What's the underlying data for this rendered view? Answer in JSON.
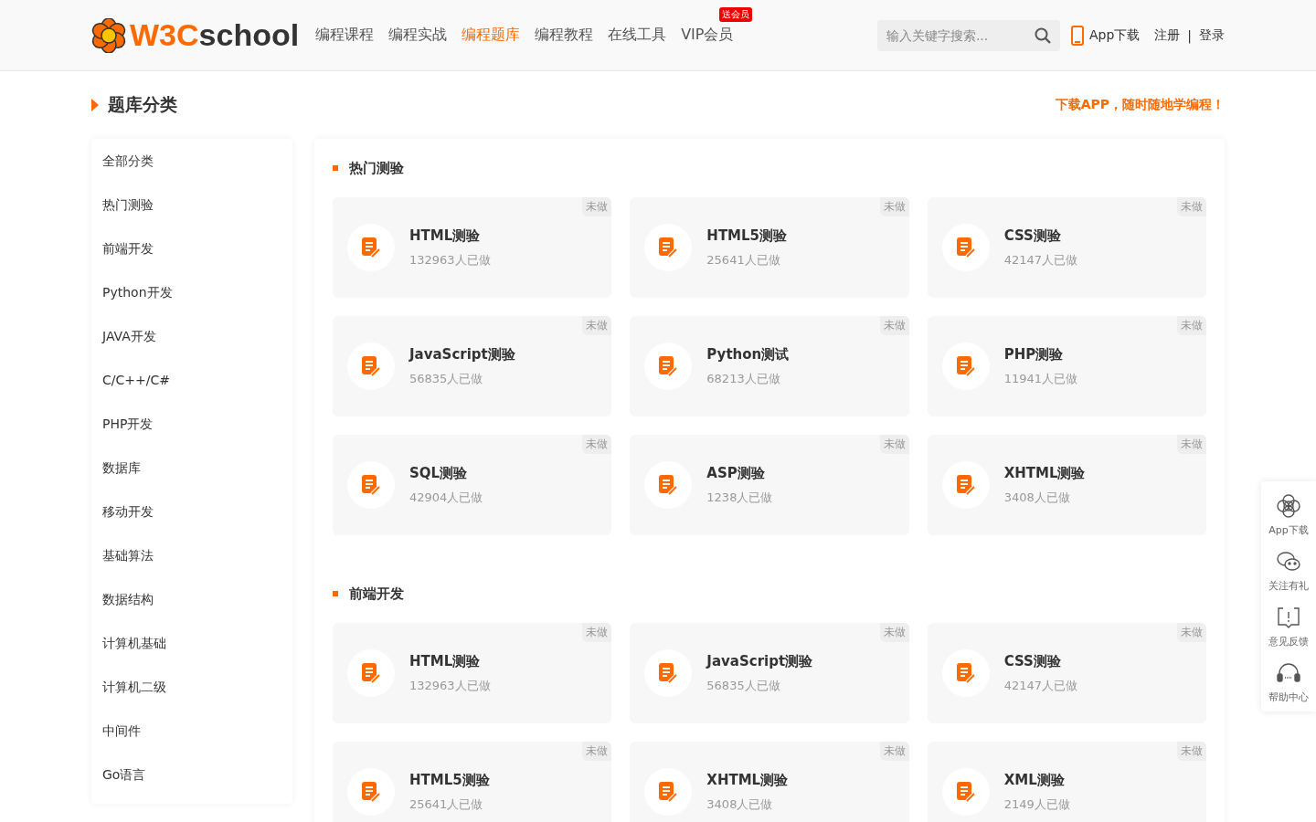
{
  "header": {
    "logo_prefix": "W3C",
    "logo_suffix": "school",
    "nav": [
      {
        "label": "编程课程",
        "selected": false
      },
      {
        "label": "编程实战",
        "selected": false
      },
      {
        "label": "编程题库",
        "selected": true
      },
      {
        "label": "编程教程",
        "selected": false
      },
      {
        "label": "在线工具",
        "selected": false
      },
      {
        "label": "VIP会员",
        "selected": false,
        "badge": "送会员"
      }
    ],
    "search": {
      "placeholder": "输入关键字搜索..."
    },
    "app_download": "App下载",
    "register": "注册",
    "separator": "|",
    "login": "登录"
  },
  "page_title": "题库分类",
  "promo": "下载APP，随时随地学编程！",
  "sidebar": {
    "items": [
      {
        "label": "全部分类",
        "selected": false
      },
      {
        "label": "热门测验",
        "selected": false
      },
      {
        "label": "前端开发",
        "selected": false
      },
      {
        "label": "Python开发",
        "selected": false
      },
      {
        "label": "JAVA开发",
        "selected": false
      },
      {
        "label": "C/C++/C#",
        "selected": false
      },
      {
        "label": "PHP开发",
        "selected": false
      },
      {
        "label": "数据库",
        "selected": false
      },
      {
        "label": "移动开发",
        "selected": false
      },
      {
        "label": "基础算法",
        "selected": false
      },
      {
        "label": "数据结构",
        "selected": false
      },
      {
        "label": "计算机基础",
        "selected": false
      },
      {
        "label": "计算机二级",
        "selected": false
      },
      {
        "label": "中间件",
        "selected": false
      },
      {
        "label": "Go语言",
        "selected": false
      }
    ]
  },
  "sections": [
    {
      "title": "热门测验",
      "quizzes": [
        {
          "name": "HTML测验",
          "count": "132963人已做",
          "status": "未做"
        },
        {
          "name": "HTML5测验",
          "count": "25641人已做",
          "status": "未做"
        },
        {
          "name": "CSS测验",
          "count": "42147人已做",
          "status": "未做"
        },
        {
          "name": "JavaScript测验",
          "count": "56835人已做",
          "status": "未做"
        },
        {
          "name": "Python测试",
          "count": "68213人已做",
          "status": "未做"
        },
        {
          "name": "PHP测验",
          "count": "11941人已做",
          "status": "未做"
        },
        {
          "name": "SQL测验",
          "count": "42904人已做",
          "status": "未做"
        },
        {
          "name": "ASP测验",
          "count": "1238人已做",
          "status": "未做"
        },
        {
          "name": "XHTML测验",
          "count": "3408人已做",
          "status": "未做"
        }
      ]
    },
    {
      "title": "前端开发",
      "quizzes": [
        {
          "name": "HTML测验",
          "count": "132963人已做",
          "status": "未做"
        },
        {
          "name": "JavaScript测验",
          "count": "56835人已做",
          "status": "未做"
        },
        {
          "name": "CSS测验",
          "count": "42147人已做",
          "status": "未做"
        },
        {
          "name": "HTML5测验",
          "count": "25641人已做",
          "status": "未做"
        },
        {
          "name": "XHTML测验",
          "count": "3408人已做",
          "status": "未做"
        },
        {
          "name": "XML测验",
          "count": "2149人已做",
          "status": "未做"
        }
      ]
    }
  ],
  "float_bar": [
    {
      "kind": "app",
      "label": "App下载"
    },
    {
      "kind": "wechat",
      "label": "关注有礼"
    },
    {
      "kind": "feedback",
      "label": "意见反馈"
    },
    {
      "kind": "help",
      "label": "帮助中心"
    }
  ]
}
